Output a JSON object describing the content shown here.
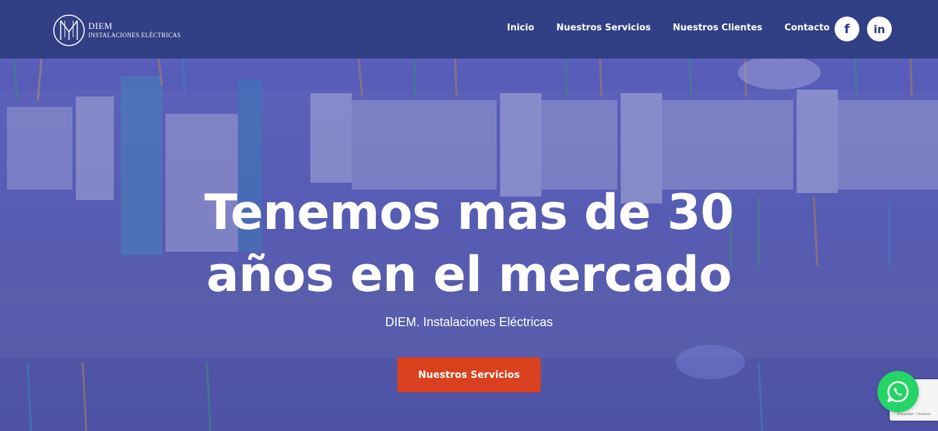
{
  "brand": {
    "name": "DIEM",
    "subtitle": "INSTALACIONES ELÉCTRICAS"
  },
  "nav": {
    "items": [
      {
        "label": "Inicio"
      },
      {
        "label": "Nuestros Servicios"
      },
      {
        "label": "Nuestros Clientes"
      },
      {
        "label": "Contacto"
      }
    ]
  },
  "social": {
    "facebook": "f",
    "linkedin": "in"
  },
  "hero": {
    "title_line1": "Tenemos mas de 30",
    "title_line2": "años en el mercado",
    "subtitle": "DIEM. Instalaciones Eléctricas",
    "cta_label": "Nuestros Servicios"
  },
  "recaptcha": {
    "text": "Privacidad - Términos"
  },
  "colors": {
    "header_bg": "#313f85",
    "cta_bg": "#d9411e",
    "whatsapp": "#25d366"
  }
}
